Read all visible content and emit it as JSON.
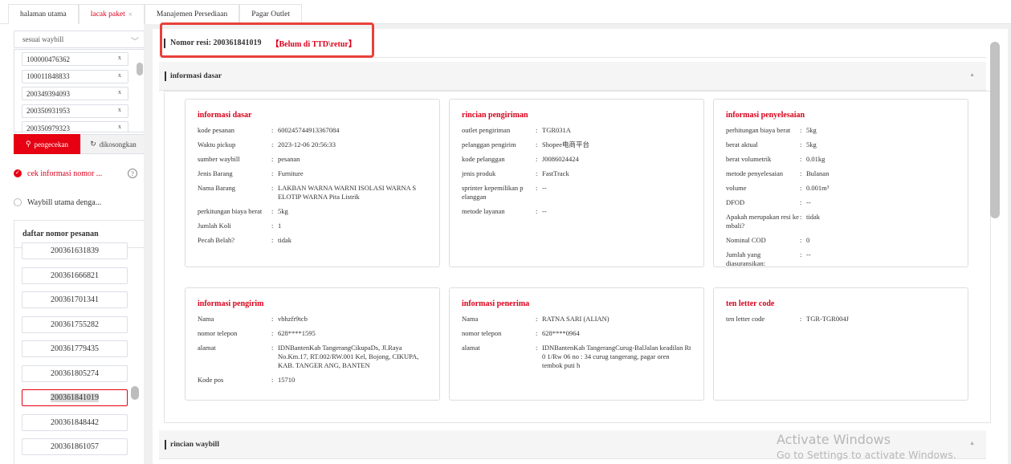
{
  "tabs": [
    {
      "label": "halaman utama",
      "active": false,
      "close": ""
    },
    {
      "label": "lacak paket",
      "active": true,
      "close": "×"
    },
    {
      "label": "Manajemen Persediaan",
      "active": false,
      "close": ""
    },
    {
      "label": "Pagar Outlet",
      "active": false,
      "close": ""
    }
  ],
  "left": {
    "select_value": "sesuai waybill",
    "waybills": [
      "100000476362",
      "100011848833",
      "200349394093",
      "200350931953",
      "200350979323"
    ],
    "check_label": "pengecekan",
    "clear_label": "dikosongkan",
    "radio1": "cek informasi nomor ...",
    "radio2": "Waybill utama denga...",
    "help": "?",
    "order_title": "daftar nomor pesanan",
    "orders": [
      "200361631839",
      "200361666821",
      "200361701341",
      "200361755282",
      "200361779435",
      "200361805274",
      "200361841019",
      "200361848442",
      "200361861057"
    ],
    "active_order": "200361841019"
  },
  "header": {
    "resi_label": "Nomor resi:",
    "resi_value": "200361841019",
    "status": "【Belum di TTD\\retur】"
  },
  "section1": "informasi dasar",
  "section2": "rincian waybill",
  "cards": {
    "dasar": {
      "title": "informasi dasar",
      "rows": [
        {
          "k": "kode pesanan",
          "v": "600245744913367084"
        },
        {
          "k": "Waktu pickup",
          "v": "2023-12-06 20:56:33"
        },
        {
          "k": "sumber waybill",
          "v": "pesanan"
        },
        {
          "k": "Jenis Barang",
          "v": "Furniture"
        },
        {
          "k": "Nama Barang",
          "v": "LAKBAN WARNA WARNI ISOLASI WARNA S ELOTIP WARNA Pita Listrik"
        },
        {
          "k": "perkitungan biaya berat",
          "v": "5kg"
        },
        {
          "k": "Jumlah Koli",
          "v": "1"
        },
        {
          "k": "Pecah Belah?",
          "v": "tidak"
        }
      ]
    },
    "pengiriman": {
      "title": "rincian pengiriman",
      "rows": [
        {
          "k": "outlet pengiriman",
          "v": "TGR031A"
        },
        {
          "k": "pelanggan pengirim",
          "v": "Shopee电商平台"
        },
        {
          "k": "kode pelanggan",
          "v": "J0086024424"
        },
        {
          "k": "jenis produk",
          "v": "FastTrack"
        },
        {
          "k": "sprinter kepemilikan p elanggan",
          "v": "--"
        },
        {
          "k": "metode layanan",
          "v": "--"
        }
      ]
    },
    "penyelesaian": {
      "title": "informasi penyelesaian",
      "rows": [
        {
          "k": "perhitungan biaya berat",
          "v": "5kg"
        },
        {
          "k": "berat aktual",
          "v": "5kg"
        },
        {
          "k": "berat volumetrik",
          "v": "0.01kg"
        },
        {
          "k": "metode penyelesaian",
          "v": "Bulanan"
        },
        {
          "k": "volume",
          "v": "0.001m³"
        },
        {
          "k": "DFOD",
          "v": "--"
        },
        {
          "k": "Apakah merupakan resi ke mbali?",
          "v": "tidak"
        },
        {
          "k": "Nominal COD",
          "v": "0"
        },
        {
          "k": "Jumlah yang diasuransikan:",
          "v": "--"
        }
      ]
    },
    "pengirim": {
      "title": "informasi pengirim",
      "rows": [
        {
          "k": "Nama",
          "v": "vbhzfr9tcb"
        },
        {
          "k": "nomor telepon",
          "v": "628****1595"
        },
        {
          "k": "alamat",
          "v": "IDNBantenKab TangerangCikupaDs, Jl.Raya No.Km.17, RT.002/RW.001 Kel, Bojong, CIKUPA, KAB. TANGER ANG, BANTEN"
        },
        {
          "k": "Kode pos",
          "v": "15710"
        }
      ]
    },
    "penerima": {
      "title": "informasi penerima",
      "rows": [
        {
          "k": "Nama",
          "v": "RATNA SARI (ALIAN)"
        },
        {
          "k": "nomor telepon",
          "v": "628****0964"
        },
        {
          "k": "alamat",
          "v": "IDNBantenKab TangerangCurug-BalJalan keadilan Rt 0 1/Rw 06 no : 34 curug tangerang, pagar oren tembok puti h"
        }
      ]
    },
    "letter": {
      "title": "ten letter code",
      "rows": [
        {
          "k": "ten letter code",
          "v": "TGR-TGR004J"
        }
      ]
    }
  },
  "watermark": {
    "line1": "Activate Windows",
    "line2": "Go to Settings to activate Windows."
  }
}
